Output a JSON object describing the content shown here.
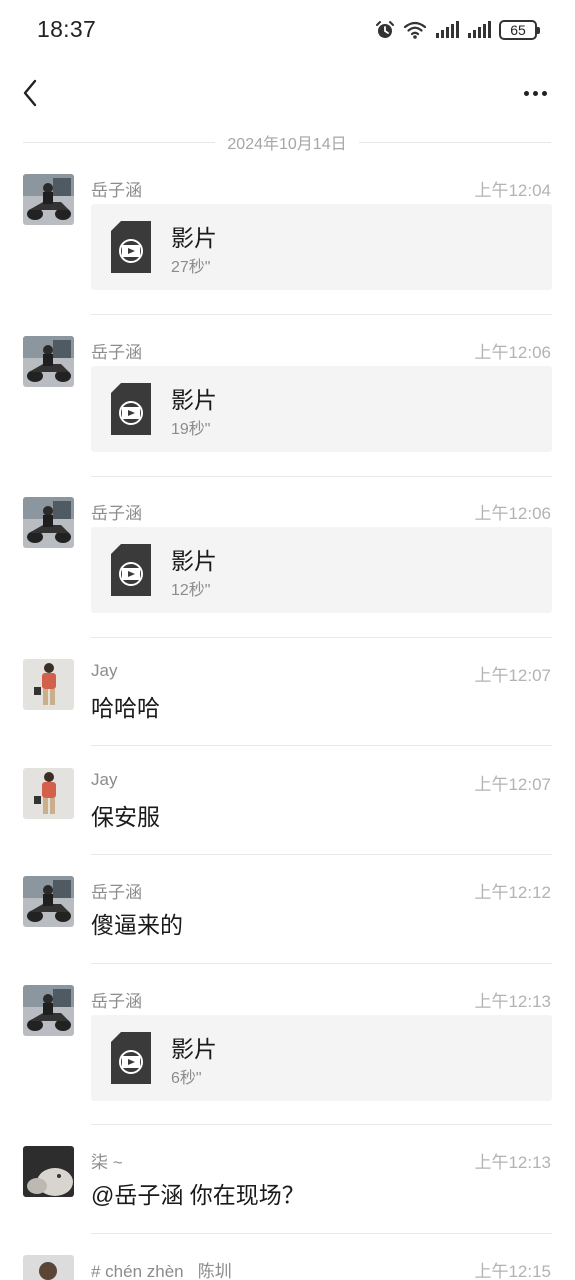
{
  "status_bar": {
    "time": "18:37",
    "battery": "65",
    "icons": [
      "alarm-icon",
      "wifi-icon",
      "signal-icon",
      "signal-icon"
    ]
  },
  "nav": {
    "back_icon": "chevron-left-icon",
    "more_icon": "more-horizontal-icon"
  },
  "date_divider": "2024年10月14日",
  "messages": [
    {
      "sender": "岳子涵",
      "time": "上午12:04",
      "type": "video",
      "title": "影片",
      "duration": "27秒\""
    },
    {
      "sender": "岳子涵",
      "time": "上午12:06",
      "type": "video",
      "title": "影片",
      "duration": "19秒\""
    },
    {
      "sender": "岳子涵",
      "time": "上午12:06",
      "type": "video",
      "title": "影片",
      "duration": "12秒\""
    },
    {
      "sender": "Jay",
      "time": "上午12:07",
      "type": "text",
      "text": "哈哈哈"
    },
    {
      "sender": "Jay",
      "time": "上午12:07",
      "type": "text",
      "text": "保安服"
    },
    {
      "sender": "岳子涵",
      "time": "上午12:12",
      "type": "text",
      "text": "傻逼来的"
    },
    {
      "sender": "岳子涵",
      "time": "上午12:13",
      "type": "video",
      "title": "影片",
      "duration": "6秒\""
    },
    {
      "sender": "柒 ~",
      "time": "上午12:13",
      "type": "text",
      "text": "@岳子涵 你在现场？"
    },
    {
      "sender": "# chén zhèn   陈圳",
      "time": "上午12:15",
      "type": "text",
      "text": ""
    }
  ]
}
